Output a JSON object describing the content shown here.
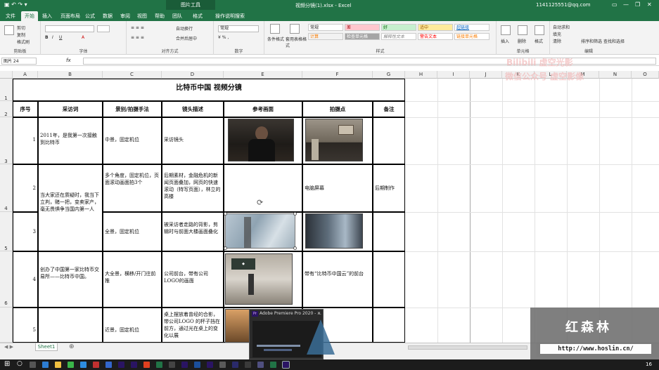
{
  "titlebar": {
    "context_tool": "图片工具",
    "title": "视频分镜(1).xlsx - Excel",
    "account": "1141125551@qq.com",
    "share": "共享"
  },
  "tabs": [
    "文件",
    "开始",
    "插入",
    "页面布局",
    "公式",
    "数据",
    "审阅",
    "视图",
    "帮助",
    "团队",
    "格式",
    "操作说明搜索"
  ],
  "ribbon": {
    "clipboard": {
      "cut": "剪切",
      "copy": "复制",
      "painter": "格式刷",
      "label": "剪贴板"
    },
    "font": {
      "label": "字体"
    },
    "alignment": {
      "wrap": "自动换行",
      "merge": "合并后居中",
      "label": "对齐方式"
    },
    "number": {
      "format": "常规",
      "label": "数字"
    },
    "styles": {
      "cond": "条件格式",
      "table": "套用表格格式",
      "cells": [
        "常规",
        "差",
        "好",
        "适中",
        "超链接",
        "计算",
        "检查单元格",
        "解释性文本",
        "警告文本",
        "链接单元格"
      ],
      "label": "样式"
    },
    "cells": {
      "insert": "插入",
      "delete": "删除",
      "format": "格式",
      "label": "单元格"
    },
    "editing": {
      "sum": "自动求和",
      "fill": "填充",
      "clear": "清除",
      "sort": "排序和筛选",
      "find": "查找和选择",
      "label": "编辑"
    }
  },
  "formula_bar": {
    "name_box": "图片 24",
    "fx": "fx"
  },
  "columns": [
    "A",
    "B",
    "C",
    "D",
    "E",
    "F",
    "G",
    "H",
    "I",
    "J",
    "K",
    "L",
    "M",
    "N",
    "O"
  ],
  "rows": [
    "1",
    "2",
    "3",
    "4",
    "5",
    "6"
  ],
  "sheet": {
    "title": "比特币中国 视频分镜",
    "headers": [
      "序号",
      "采访词",
      "景别/拍摄手法",
      "镜头描述",
      "参考画面",
      "拍摄点",
      "备注"
    ],
    "rows": [
      {
        "no": "1",
        "quote": "2011年，是我第一次接触到比特币",
        "shot": "中景，固定机位",
        "desc": "采访镜头",
        "spot": "",
        "note": ""
      },
      {
        "no": "2",
        "quote": "",
        "shot": "多个角度，固定机位，页面滚动画面拍3个",
        "desc": "后期素材，金融危机的新闻页面叠加，网页的快速滚动（特写页面），林立的高楼",
        "spot": "电脑屏幕",
        "note": "后期制作"
      },
      {
        "no": "3",
        "quote": "",
        "shot": "全景，固定机位",
        "desc": "被采访者走路的背影，剪辑时与前面大楼画面叠化",
        "spot": "",
        "note": ""
      },
      {
        "no": "4",
        "quote": "创办了中国第一家比特币交易所——比特币中国。",
        "shot": "大全景，横移/开门往前推",
        "desc": "公司前台，带有公司LOGO的画面",
        "spot": "带有“比特币中国云”的前台",
        "note": ""
      },
      {
        "no": "5",
        "quote": "",
        "shot": "近景，固定机位",
        "desc": "桌上摆放着曾经的合影，带公司LOGO 的杯子挡在前方，通过光在桌上的变化以展",
        "spot": "",
        "note": ""
      }
    ],
    "merged_quote": "当大家还在质疑时，我当下立判，赌一把，变卖家产，毫无畏惧争当国内第一人"
  },
  "watermark": {
    "line1": "Bilibili 虚空光影",
    "line2": "微信公众号 虚空影像"
  },
  "sheet_tab": "Sheet1",
  "popup": {
    "title": "Adobe Premiere Pro 2020 - ..."
  },
  "overlay": {
    "brand": "红森林",
    "url": "http://www.hoslin.cn/"
  },
  "taskbar": {
    "time": "16"
  },
  "colors": {
    "excel_green": "#217346",
    "accent": "#217346"
  }
}
